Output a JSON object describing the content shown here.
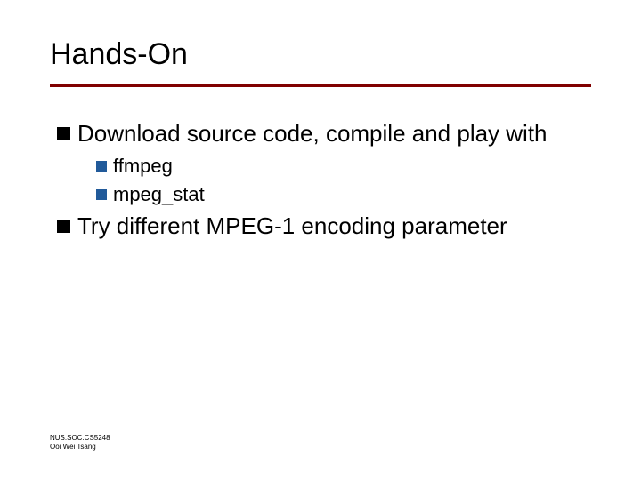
{
  "title": "Hands-On",
  "items": [
    {
      "text": "Download source code, compile and play with",
      "children": [
        {
          "text": "ffmpeg"
        },
        {
          "text": "mpeg_stat"
        }
      ]
    },
    {
      "text": "Try different MPEG-1 encoding parameter",
      "children": []
    }
  ],
  "footer": {
    "line1": "NUS.SOC.CS5248",
    "line2": "Ooi Wei Tsang"
  }
}
